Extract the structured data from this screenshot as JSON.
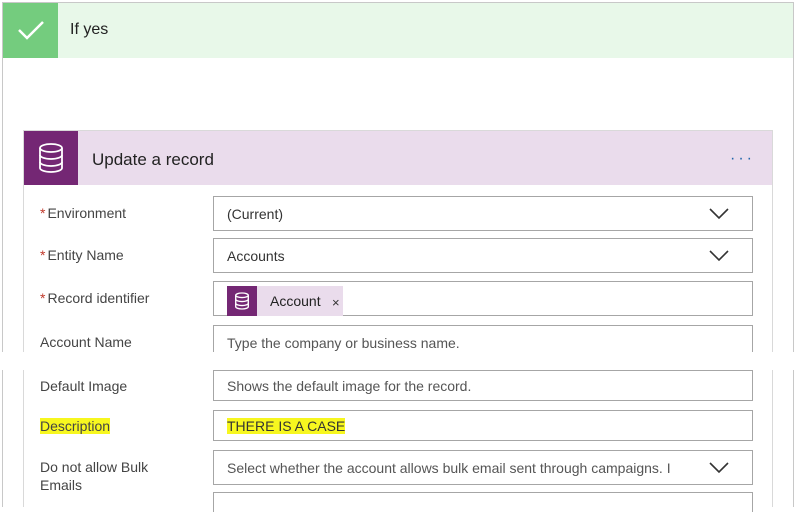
{
  "condition": {
    "title": "If yes",
    "icon": "checkmark-icon"
  },
  "action": {
    "title": "Update a record",
    "icon": "database-icon",
    "more_label": "···",
    "more_icon": "more-options-icon"
  },
  "fields": {
    "environment": {
      "label": "Environment",
      "required": "*",
      "value": "(Current)"
    },
    "entity_name": {
      "label": "Entity Name",
      "required": "*",
      "value": "Accounts"
    },
    "record_identifier": {
      "label": "Record identifier",
      "required": "*",
      "token_label": "Account",
      "token_remove": "×"
    },
    "account_name": {
      "label": "Account Name",
      "placeholder": "Type the company or business name."
    },
    "default_image": {
      "label": "Default Image",
      "placeholder": "Shows the default image for the record."
    },
    "description": {
      "label": "Description",
      "value": "THERE IS A CASE"
    },
    "bulk_emails": {
      "label_line1": "Do not allow Bulk",
      "label_line2": "Emails",
      "placeholder": "Select whether the account allows bulk email sent through campaigns. I"
    }
  },
  "colors": {
    "accent_purple": "#742774",
    "header_purple_bg": "#eadcec",
    "success_green": "#74cc7e",
    "success_bg": "#e8f8e9",
    "highlight": "#f7f71f",
    "link_blue": "#2266aa"
  }
}
